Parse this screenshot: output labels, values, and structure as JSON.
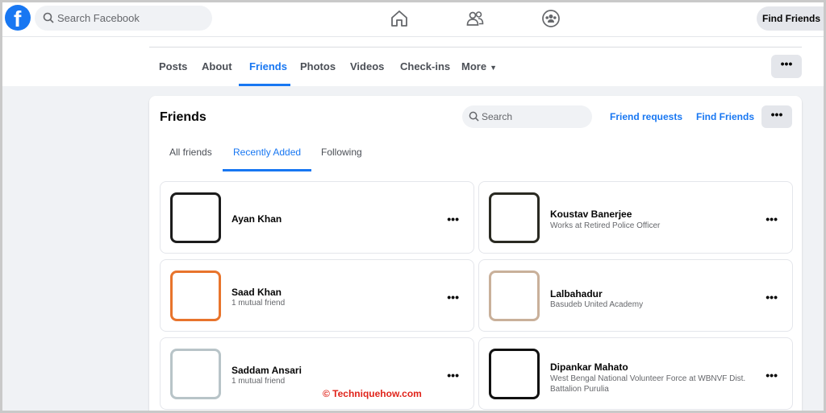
{
  "topbar": {
    "logo_letter": "f",
    "search_placeholder": "Search Facebook",
    "find_friends_label": "Find Friends"
  },
  "profile_tabs": [
    {
      "label": "Posts",
      "active": false
    },
    {
      "label": "About",
      "active": false
    },
    {
      "label": "Friends",
      "active": true
    },
    {
      "label": "Photos",
      "active": false
    },
    {
      "label": "Videos",
      "active": false
    },
    {
      "label": "Check-ins",
      "active": false
    },
    {
      "label": "More",
      "active": false
    }
  ],
  "more_dots": "•••",
  "friends_card": {
    "title": "Friends",
    "search_placeholder": "Search",
    "friend_requests_label": "Friend requests",
    "find_friends_label": "Find Friends",
    "more_dots": "•••",
    "sub_tabs": [
      {
        "label": "All friends",
        "active": false
      },
      {
        "label": "Recently Added",
        "active": true
      },
      {
        "label": "Following",
        "active": false
      }
    ]
  },
  "friends": [
    {
      "name": "Ayan Khan",
      "subtitle": "",
      "dots": "•••",
      "frame_color": "#1c1c1c"
    },
    {
      "name": "Koustav Banerjee",
      "subtitle": "Works at Retired Police Officer",
      "dots": "•••",
      "frame_color": "#2a2a22"
    },
    {
      "name": "Saad Khan",
      "subtitle": "1 mutual friend",
      "dots": "•••",
      "frame_color": "#e8742c"
    },
    {
      "name": "Lalbahadur",
      "subtitle": "Basudeb United Academy",
      "dots": "•••",
      "frame_color": "#c9b09a"
    },
    {
      "name": "Saddam Ansari",
      "subtitle": "1 mutual friend",
      "dots": "•••",
      "frame_color": "#b8c4c8"
    },
    {
      "name": "Dipankar Mahato",
      "subtitle": "West Bengal National Volunteer Force at WBNVF Dist. Battalion Purulia",
      "dots": "•••",
      "frame_color": "#111111"
    }
  ],
  "watermark": "© Techniquehow.com",
  "colors": {
    "brand_blue": "#1877f2",
    "background": "#f0f2f5",
    "watermark_red": "#e0241b"
  }
}
